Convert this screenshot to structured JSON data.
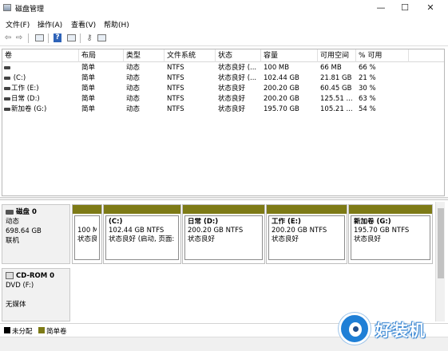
{
  "window": {
    "title": "磁盘管理",
    "min_glyph": "—",
    "max_glyph": "☐",
    "close_glyph": "✕"
  },
  "menu": [
    "文件(F)",
    "操作(A)",
    "查看(V)",
    "帮助(H)"
  ],
  "toolbar": {
    "back_glyph": "⇦",
    "forward_glyph": "⇨",
    "help_glyph": "?",
    "icons": [
      "back-icon",
      "forward-icon",
      "console-tree-icon",
      "help-icon",
      "properties-icon",
      "key-icon",
      "refresh-icon"
    ]
  },
  "volume_table": {
    "columns": [
      "卷",
      "布局",
      "类型",
      "文件系统",
      "状态",
      "容量",
      "可用空间",
      "% 可用"
    ],
    "rows": [
      [
        "",
        "简单",
        "动态",
        "NTFS",
        "状态良好 (...",
        "100 MB",
        "66 MB",
        "66 %"
      ],
      [
        "(C:)",
        "简单",
        "动态",
        "NTFS",
        "状态良好 (...",
        "102.44 GB",
        "21.81 GB",
        "21 %"
      ],
      [
        "工作 (E:)",
        "简单",
        "动态",
        "NTFS",
        "状态良好",
        "200.20 GB",
        "60.45 GB",
        "30 %"
      ],
      [
        "日常 (D:)",
        "简单",
        "动态",
        "NTFS",
        "状态良好",
        "200.20 GB",
        "125.51 ...",
        "63 %"
      ],
      [
        "新加卷 (G:)",
        "简单",
        "动态",
        "NTFS",
        "状态良好",
        "195.70 GB",
        "105.21 ...",
        "54 %"
      ]
    ]
  },
  "disk0": {
    "name": "磁盘 0",
    "type": "动态",
    "size": "698.64 GB",
    "status": "联机",
    "partitions": [
      {
        "name": "",
        "size_fs": "100 M",
        "status": "状态良"
      },
      {
        "name": "(C:)",
        "size_fs": "102.44 GB NTFS",
        "status": "状态良好 (启动, 页面:"
      },
      {
        "name": "日常 (D:)",
        "size_fs": "200.20 GB NTFS",
        "status": "状态良好"
      },
      {
        "name": "工作 (E:)",
        "size_fs": "200.20 GB NTFS",
        "status": "状态良好"
      },
      {
        "name": "新加卷 (G:)",
        "size_fs": "195.70 GB NTFS",
        "status": "状态良好"
      }
    ],
    "partition_color": "#7d7a16"
  },
  "cdrom0": {
    "name": "CD-ROM 0",
    "drive": "DVD (F:)",
    "media": "无媒体"
  },
  "legend": [
    {
      "label": "未分配",
      "color": "#000000"
    },
    {
      "label": "简单卷",
      "color": "#7d7a16"
    }
  ],
  "watermark": {
    "text": "好装机",
    "color": "#1f7fd6"
  }
}
